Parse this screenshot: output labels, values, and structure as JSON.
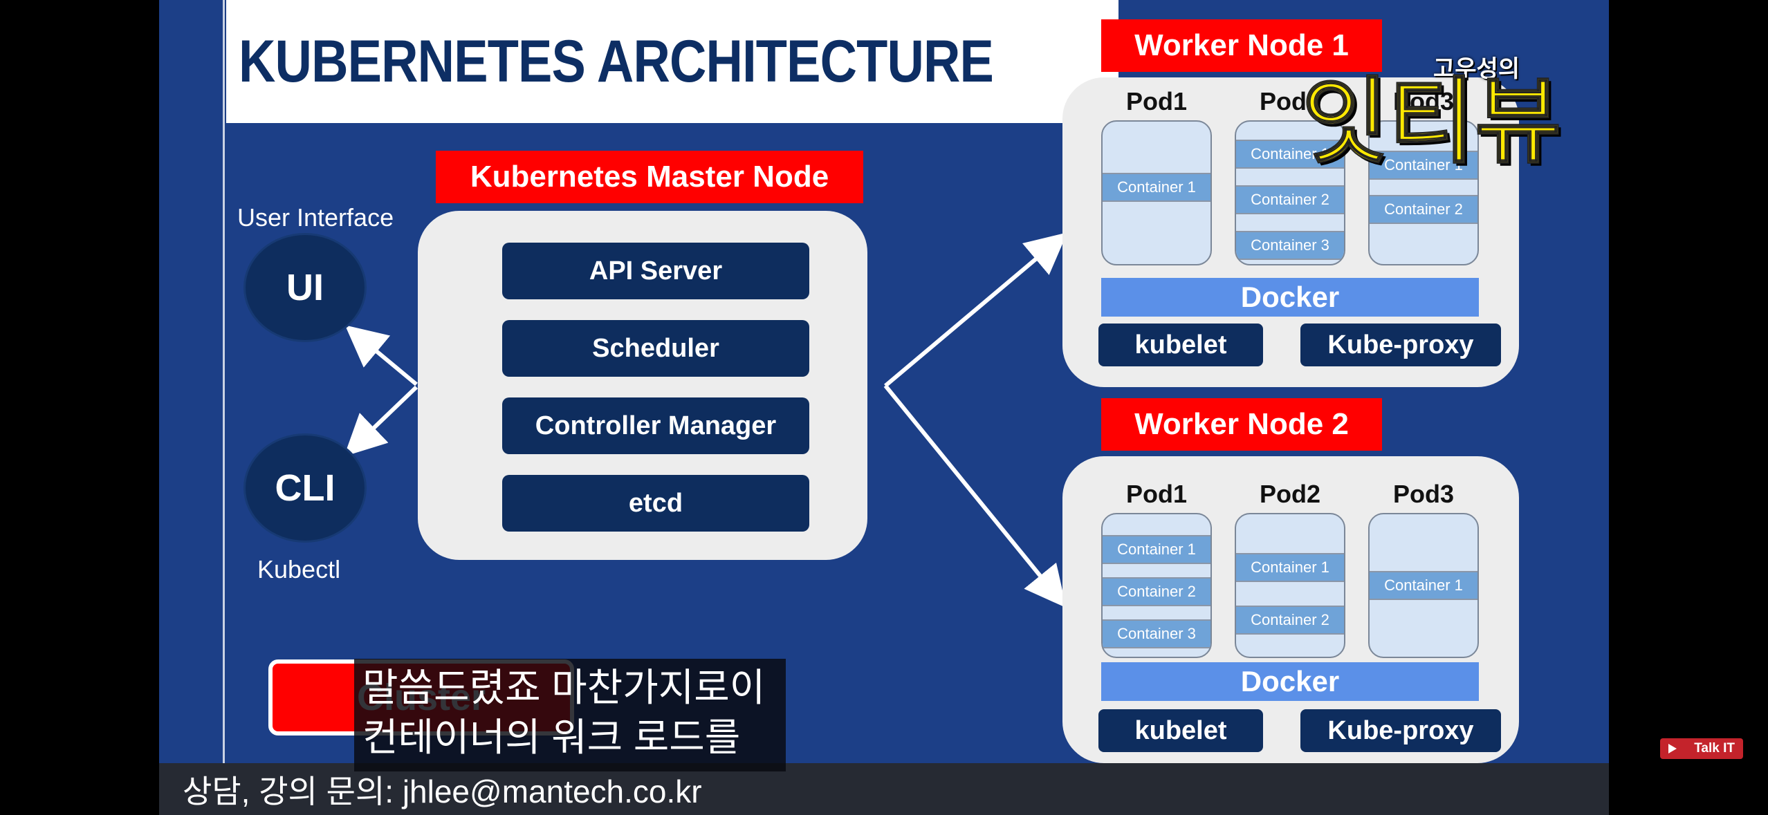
{
  "slide": {
    "title": "KUBERNETES ARCHITECTURE",
    "master": {
      "label": "Kubernetes Master Node",
      "components": [
        "API Server",
        "Scheduler",
        "Controller Manager",
        "etcd"
      ]
    },
    "interfaces": {
      "ui_caption": "User Interface",
      "ui": "UI",
      "cli": "CLI",
      "cli_caption": "Kubectl"
    },
    "workers": [
      {
        "label": "Worker Node 1",
        "pods": [
          {
            "name": "Pod1",
            "containers": [
              "Container 1"
            ]
          },
          {
            "name": "Pod2",
            "containers": [
              "Container 1",
              "Container 2",
              "Container 3"
            ]
          },
          {
            "name": "Pod3",
            "containers": [
              "Container 1",
              "Container 2"
            ]
          }
        ],
        "docker": "Docker",
        "kubelet": "kubelet",
        "kube_proxy": "Kube-proxy"
      },
      {
        "label": "Worker Node 2",
        "pods": [
          {
            "name": "Pod1",
            "containers": [
              "Container 1",
              "Container 2",
              "Container 3"
            ]
          },
          {
            "name": "Pod2",
            "containers": [
              "Container 1",
              "Container 2"
            ]
          },
          {
            "name": "Pod3",
            "containers": [
              "Container 1"
            ]
          }
        ],
        "docker": "Docker",
        "kubelet": "kubelet",
        "kube_proxy": "Kube-proxy"
      }
    ],
    "cluster_button": "Cluster"
  },
  "overlay": {
    "subtitle_lines": [
      "말씀드렸죠 마찬가지로이",
      "컨테이너의 워크 로드를"
    ],
    "contact": "상담, 강의 문의: jhlee@mantech.co.kr",
    "watermark_small": "고우성의",
    "watermark_big": "잇티뷰",
    "channel_badge": "Talk IT"
  },
  "colors": {
    "slide_bg": "#1c3f87",
    "navy": "#0e2d5e",
    "red": "#ff0000",
    "docker_blue": "#5b90e8",
    "container_blue": "#6fa3d8",
    "watermark_yellow": "#ffe900"
  }
}
